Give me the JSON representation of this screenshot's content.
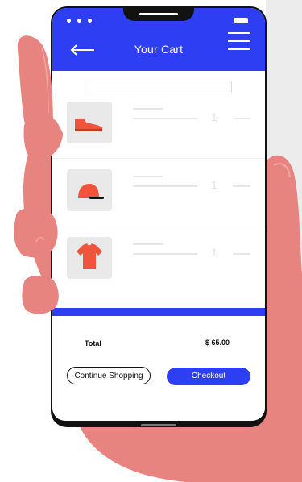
{
  "header": {
    "title": "Your Cart"
  },
  "icons": {
    "back": "arrow-left-icon",
    "menu": "hamburger-menu-icon",
    "status_dots": "signal-dots-icon",
    "battery": "battery-icon"
  },
  "cart": {
    "items": [
      {
        "name_icon": "shoe-icon",
        "quantity": "1"
      },
      {
        "name_icon": "cap-icon",
        "quantity": "1"
      },
      {
        "name_icon": "tshirt-icon",
        "quantity": "1"
      }
    ],
    "total_label": "Total",
    "total_value": "$ 65.00"
  },
  "actions": {
    "continue_label": "Continue Shopping",
    "checkout_label": "Checkout"
  },
  "colors": {
    "accent": "#2e3ef2",
    "product": "#f0543c",
    "hand": "#e78480"
  }
}
